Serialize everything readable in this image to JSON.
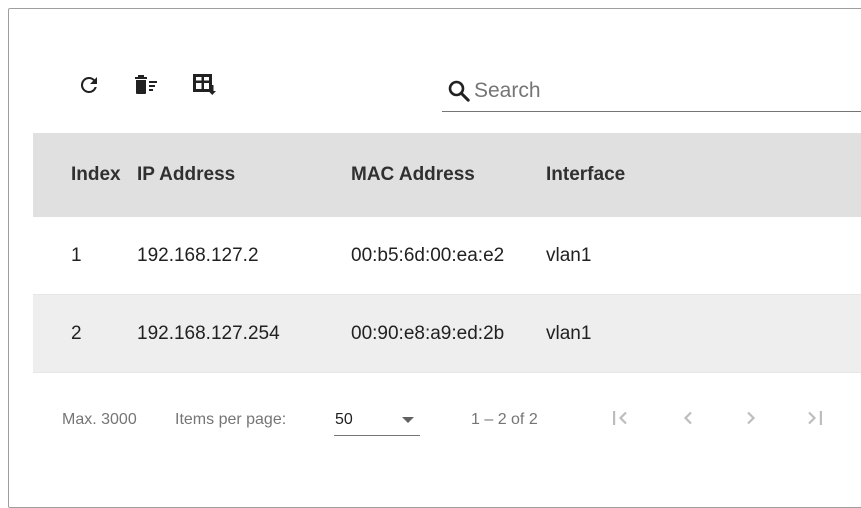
{
  "toolbar": {
    "refresh_icon": "refresh-icon",
    "clear_icon": "clear-all-icon",
    "export_icon": "table-export-icon"
  },
  "search": {
    "placeholder": "Search",
    "value": ""
  },
  "table": {
    "columns": [
      "Index",
      "IP Address",
      "MAC Address",
      "Interface"
    ],
    "rows": [
      {
        "index": "1",
        "ip": "192.168.127.2",
        "mac": "00:b5:6d:00:ea:e2",
        "interface": "vlan1"
      },
      {
        "index": "2",
        "ip": "192.168.127.254",
        "mac": "00:90:e8:a9:ed:2b",
        "interface": "vlan1"
      }
    ]
  },
  "paginator": {
    "max_label": "Max. 3000",
    "items_per_page_label": "Items per page:",
    "items_per_page_value": "50",
    "range_label": "1 – 2 of 2"
  },
  "colors": {
    "header_bg": "#e0e0e0",
    "alt_row_bg": "#eeeeee",
    "icon": "#212121",
    "disabled_icon": "#bdbdbd"
  }
}
